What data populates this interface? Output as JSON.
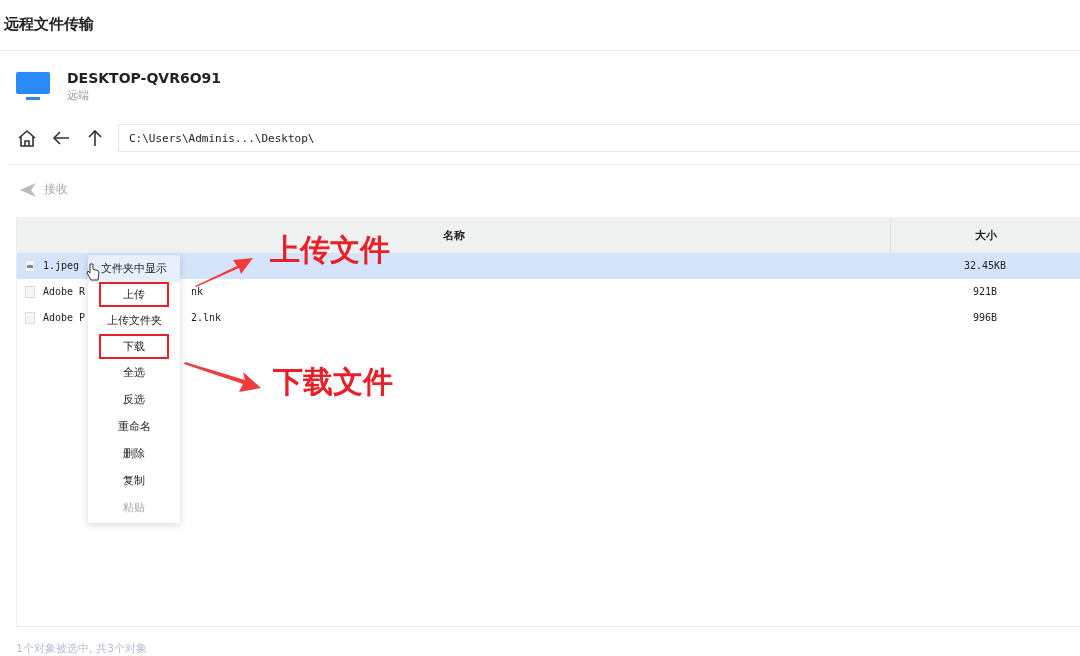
{
  "window": {
    "title": "远程文件传输"
  },
  "device": {
    "name": "DESKTOP-QVR6O91",
    "subtitle": "远端"
  },
  "path": {
    "value": "C:\\Users\\Adminis...\\Desktop\\"
  },
  "toolbar": {
    "receive": {
      "label": "接收",
      "disabled": true
    }
  },
  "table": {
    "columns": [
      "名称",
      "大小"
    ],
    "rows": [
      {
        "name_start": "1.jpeg",
        "name_end": "",
        "size": "32.45KB",
        "selected": true,
        "kind": "image"
      },
      {
        "name_start": "Adobe R",
        "name_end": "nk",
        "size": "921B",
        "selected": false,
        "kind": "file"
      },
      {
        "name_start": "Adobe P",
        "name_end": "2.lnk",
        "size": "996B",
        "selected": false,
        "kind": "file"
      }
    ]
  },
  "context_menu": {
    "items": [
      {
        "label": "文件夹中显示",
        "hovered": true,
        "highlighted": false,
        "disabled": false
      },
      {
        "label": "上传",
        "hovered": false,
        "highlighted": true,
        "disabled": false
      },
      {
        "label": "上传文件夹",
        "hovered": false,
        "highlighted": false,
        "disabled": false
      },
      {
        "label": "下载",
        "hovered": false,
        "highlighted": true,
        "disabled": false
      },
      {
        "label": "全选",
        "hovered": false,
        "highlighted": false,
        "disabled": false
      },
      {
        "label": "反选",
        "hovered": false,
        "highlighted": false,
        "disabled": false
      },
      {
        "label": "重命名",
        "hovered": false,
        "highlighted": false,
        "disabled": false
      },
      {
        "label": "删除",
        "hovered": false,
        "highlighted": false,
        "disabled": false
      },
      {
        "label": "复制",
        "hovered": false,
        "highlighted": false,
        "disabled": false
      },
      {
        "label": "粘贴",
        "hovered": false,
        "highlighted": false,
        "disabled": true
      }
    ]
  },
  "annotations": [
    {
      "text": "上传文件"
    },
    {
      "text": "下载文件"
    }
  ],
  "status_bar": {
    "text": "1个对象被选中, 共3个对象"
  }
}
